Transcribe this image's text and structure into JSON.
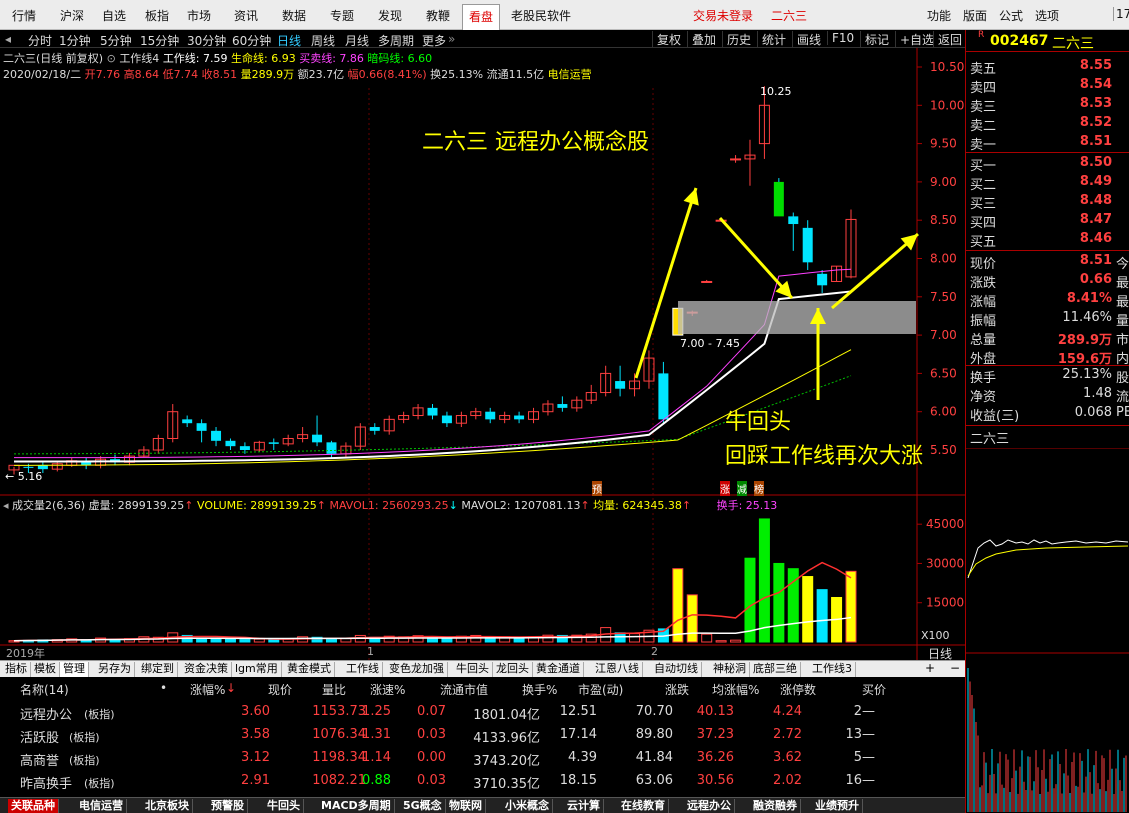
{
  "menu": {
    "items": [
      "行情",
      "沪深",
      "自选",
      "板指",
      "市场",
      "资讯",
      "数据",
      "专题",
      "发现",
      "教鞭",
      "看盘",
      "老股民软件"
    ],
    "active": "看盘",
    "trade_login": "交易未登录",
    "stock_title": "二六三",
    "right_items": [
      "功能",
      "版面",
      "公式",
      "选项"
    ],
    "clock_partial": "17"
  },
  "toolbar": {
    "periods": [
      "分时",
      "1分钟",
      "5分钟",
      "15分钟",
      "30分钟",
      "60分钟",
      "日线",
      "周线",
      "月线",
      "多周期",
      "更多"
    ],
    "active_period": "日线",
    "right_buttons": [
      "复权",
      "叠加",
      "历史",
      "统计",
      "画线",
      "F10",
      "标记",
      "+自选",
      "返回"
    ]
  },
  "chart_info": {
    "line1": {
      "name": "二六三(日线 前复权)",
      "ind_name": "工作线4",
      "work_line": "工作线: 7.59",
      "life_line": "生命线: 6.93",
      "buy_line": "买卖线: 7.86",
      "hidden_line": "暗码线: 6.60"
    },
    "line2": {
      "date": "2020/02/18/二",
      "open": "开7.76",
      "high": "高8.64",
      "low": "低7.74",
      "close": "收8.51",
      "volume": "量289.9万",
      "amount": "额23.7亿",
      "change": "幅0.66(8.41%)",
      "turnover": "换25.13%",
      "float_cap": "流通11.5亿",
      "sector": "电信运营"
    }
  },
  "annotations": {
    "headline": "二六三  远程办公概念股",
    "note1": "牛回头",
    "note2": "回踩工作线再次大涨",
    "box_label": "7.00 - 7.45",
    "max_label": "10.25",
    "min_label": "5.16",
    "markers": [
      "预",
      "涨",
      "减",
      "榜"
    ]
  },
  "price_axis": [
    "10.50",
    "10.00",
    "9.50",
    "9.00",
    "8.50",
    "8.00",
    "7.50",
    "7.00",
    "6.50",
    "6.00",
    "5.50"
  ],
  "volume_info": {
    "name": "成交量2(6,36)",
    "virtual": "虚量: 2899139.25",
    "volume": "VOLUME: 2899139.25",
    "mavol1": "MAVOL1: 2560293.25",
    "mavol2": "MAVOL2: 1207081.13",
    "avg": "均量: 624345.38",
    "turnover": "换手: 25.13"
  },
  "volume_axis": [
    "45000",
    "30000",
    "15000"
  ],
  "volume_unit": "X100",
  "x_axis": {
    "label_2019": "2019年",
    "m1": "1",
    "m2": "2"
  },
  "period_label": "日线",
  "right_panel": {
    "code": "002467",
    "name": "二六三",
    "sell": [
      {
        "label": "卖五",
        "value": "8.55"
      },
      {
        "label": "卖四",
        "value": "8.54"
      },
      {
        "label": "卖三",
        "value": "8.53"
      },
      {
        "label": "卖二",
        "value": "8.52"
      },
      {
        "label": "卖一",
        "value": "8.51"
      }
    ],
    "buy": [
      {
        "label": "买一",
        "value": "8.50"
      },
      {
        "label": "买二",
        "value": "8.49"
      },
      {
        "label": "买三",
        "value": "8.48"
      },
      {
        "label": "买四",
        "value": "8.47"
      },
      {
        "label": "买五",
        "value": "8.46"
      }
    ],
    "stats": [
      {
        "label": "现价",
        "value": "8.51",
        "extra": "今",
        "color": "red"
      },
      {
        "label": "涨跌",
        "value": "0.66",
        "extra": "最",
        "color": "red"
      },
      {
        "label": "涨幅",
        "value": "8.41%",
        "extra": "最",
        "color": "red"
      },
      {
        "label": "振幅",
        "value": "11.46%",
        "extra": "量",
        "color": "white"
      },
      {
        "label": "总量",
        "value": "289.9万",
        "extra": "市",
        "color": "red"
      },
      {
        "label": "外盘",
        "value": "159.6万",
        "extra": "内",
        "color": "red"
      }
    ],
    "stats2": [
      {
        "label": "换手",
        "value": "25.13%",
        "extra": "股"
      },
      {
        "label": "净资",
        "value": "1.48",
        "extra": "流"
      },
      {
        "label": "收益(三)",
        "value": "0.068",
        "extra": "PE"
      }
    ],
    "mini_name": "二六三"
  },
  "bottom_tabs": [
    "指标",
    "模板",
    "管理",
    "另存为",
    "绑定到",
    "资金决策",
    "lgm常用",
    "黄金模式",
    "工作线",
    "变色龙加强",
    "牛回头",
    "龙回头",
    "黄金通道",
    "江恩八线",
    "自动切线",
    "神秘洞",
    "底部三绝",
    "工作线3"
  ],
  "bottom_tabs_active": "管理",
  "table": {
    "headers": [
      "名称(14)",
      "涨幅%",
      "现价",
      "量比",
      "涨速%",
      "流通市值",
      "换手%",
      "市盈(动)",
      "涨跌",
      "均涨幅%",
      "涨停数",
      "买价"
    ],
    "rows": [
      {
        "name": "远程办公",
        "tag": "(板指)",
        "chg": "3.60",
        "price": "1153.73",
        "vr": "1.25",
        "speed": "0.07",
        "cap": "1801.04亿",
        "turn": "12.51",
        "pe": "70.70",
        "diff": "40.13",
        "avg": "4.24",
        "limit": "2",
        "bid": "—"
      },
      {
        "name": "活跃股",
        "tag": "(板指)",
        "chg": "3.58",
        "price": "1076.34",
        "vr": "1.31",
        "speed": "0.03",
        "cap": "4133.96亿",
        "turn": "17.14",
        "pe": "89.80",
        "diff": "37.23",
        "avg": "2.72",
        "limit": "13",
        "bid": "—"
      },
      {
        "name": "高商誉",
        "tag": "(板指)",
        "chg": "3.12",
        "price": "1198.34",
        "vr": "1.14",
        "speed": "0.00",
        "cap": "3743.20亿",
        "turn": "4.39",
        "pe": "41.84",
        "diff": "36.26",
        "avg": "3.62",
        "limit": "5",
        "bid": "—"
      },
      {
        "name": "昨高换手",
        "tag": "(板指)",
        "chg": "2.91",
        "price": "1082.21",
        "vr": "0.88",
        "speed": "0.03",
        "cap": "3710.35亿",
        "turn": "18.15",
        "pe": "63.06",
        "diff": "30.56",
        "avg": "2.02",
        "limit": "16",
        "bid": "—"
      }
    ]
  },
  "sector_tabs": [
    "关联品种",
    "电信运营",
    "北京板块",
    "预警股",
    "牛回头",
    "MACD多周期",
    "5G概念",
    "物联网",
    "小米概念",
    "云计算",
    "在线教育",
    "远程办公",
    "融资融券",
    "业绩预升"
  ],
  "colors": {
    "up": "#ff4040",
    "down": "#00e5ff",
    "accent_yellow": "#ffff00",
    "work_line": "#ffffff",
    "buy_line": "#ff40ff"
  }
}
